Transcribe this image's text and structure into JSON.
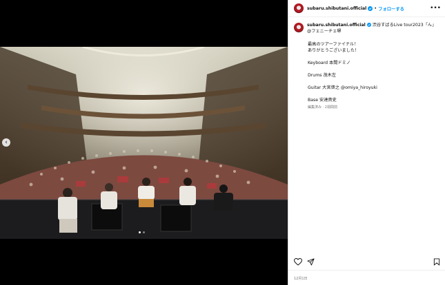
{
  "post": {
    "username": "subaru.shibutani.official",
    "follow_label": "フォローする",
    "separator": "•",
    "more_label": "•••",
    "caption": {
      "tour_title": "渋谷すばるLive tour2023「ん」@フェニーチェ堺",
      "line1": "最高のツアーファイナル！",
      "line2": "ありがとうございました！",
      "keyboard": "Keyboard 本間ドミノ",
      "drums": "Drums 茂木左",
      "guitar_prefix": "Guitar 大宮啓之 ",
      "guitar_mention": "@omiya_hiroyuki",
      "base": "Base 安達貴史"
    },
    "edited_label": "編集済み · 2週間前",
    "date": "12月1日"
  },
  "icons": {
    "avatar": "avatar-icon",
    "verified": "verified-badge-icon",
    "like": "heart-icon",
    "share": "send-icon",
    "save": "bookmark-icon",
    "prev": "chevron-left-icon"
  },
  "colors": {
    "link": "#0095f6",
    "verified": "#0095f6",
    "mention": "#00376b",
    "muted": "#737373"
  },
  "carousel": {
    "slides": 2,
    "active": 1
  }
}
